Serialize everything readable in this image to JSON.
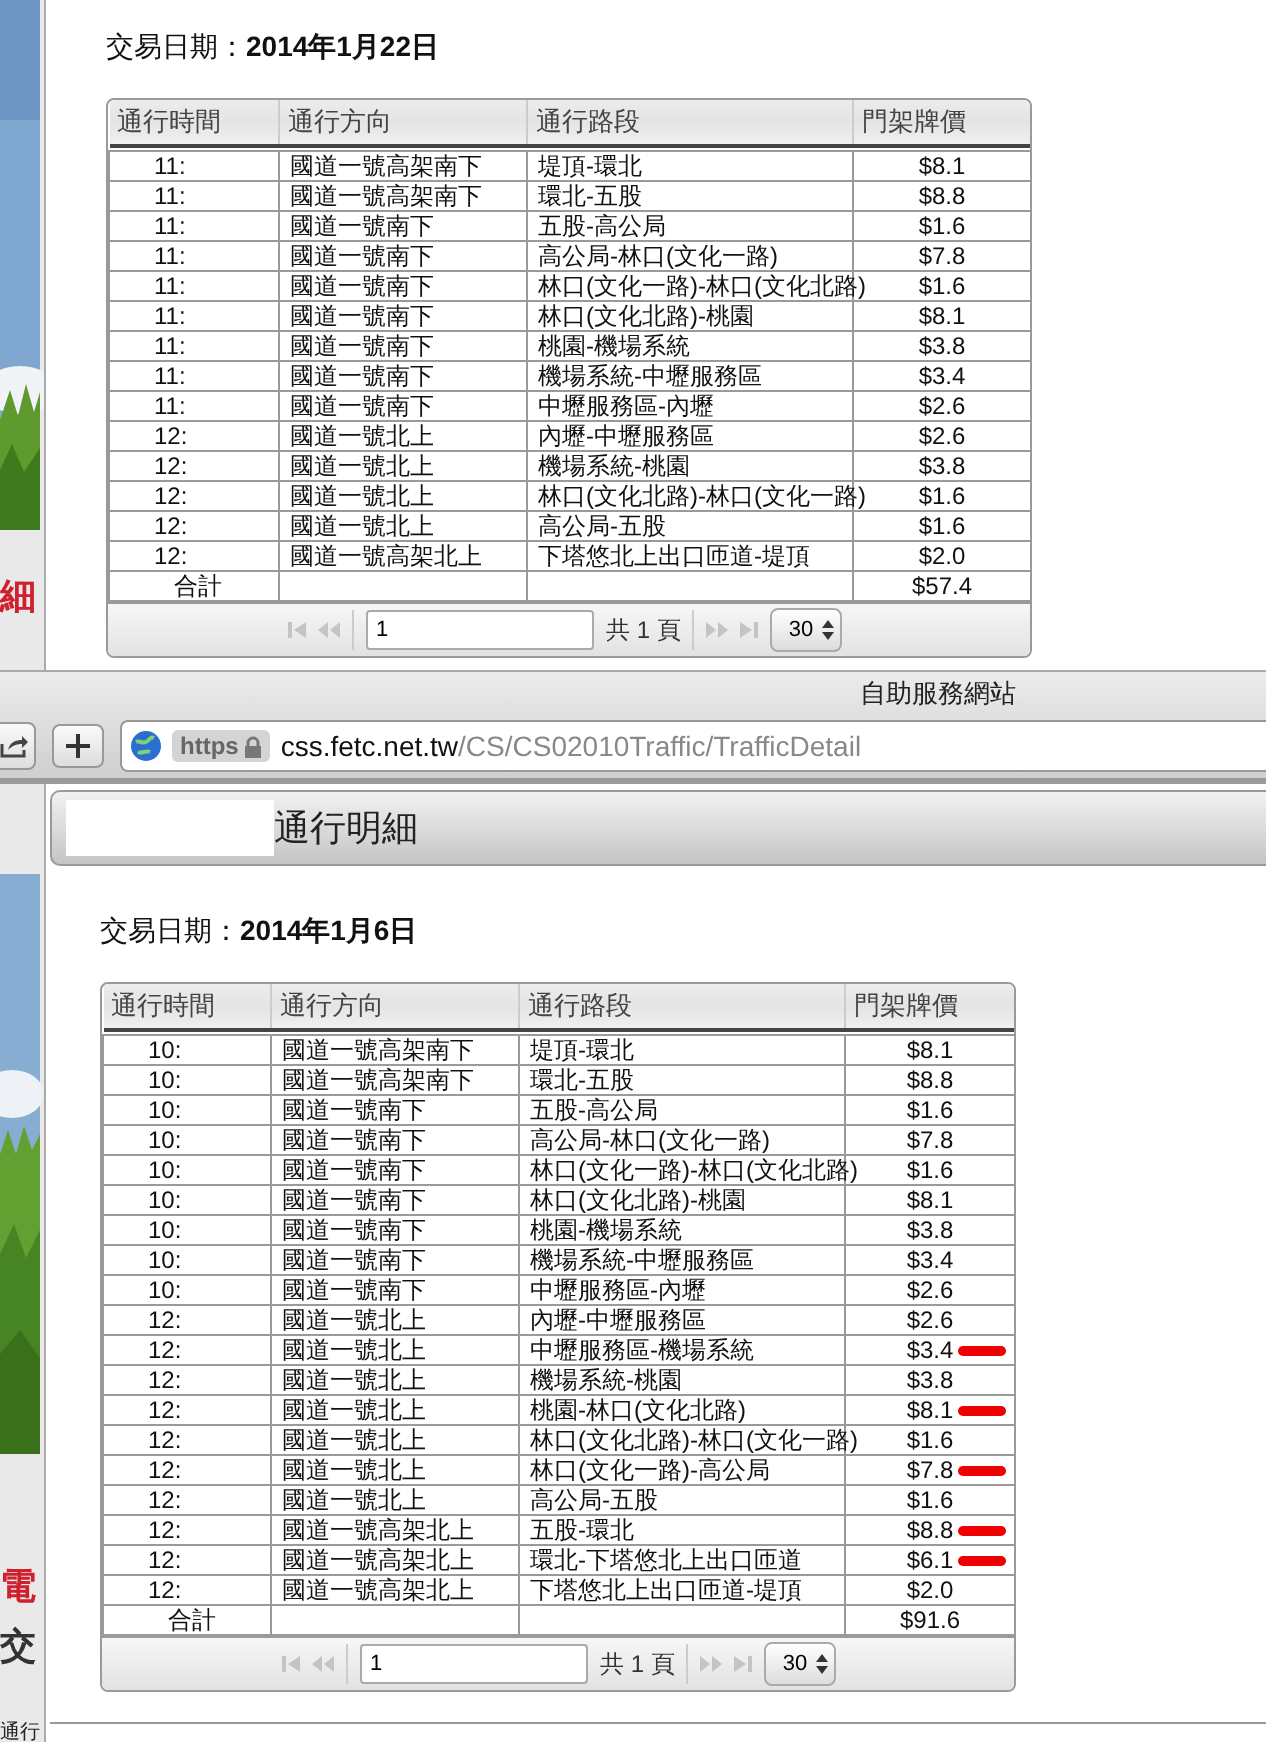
{
  "upper_strip": {
    "texts": [
      {
        "text": "細",
        "color": "#d0202e"
      }
    ]
  },
  "upper_page": {
    "date": "交易日期：**2014年1月22日**",
    "table": {
      "columns": [
        "通行時間",
        "通行方向",
        "通行路段",
        "門架牌價"
      ],
      "rows": [
        {
          "time": "11:",
          "direction": "國道一號高架南下",
          "section": "堤頂-環北",
          "price": "$8.1",
          "marked": false
        },
        {
          "time": "11:",
          "direction": "國道一號高架南下",
          "section": "環北-五股",
          "price": "$8.8",
          "marked": false
        },
        {
          "time": "11:",
          "direction": "國道一號南下",
          "section": "五股-高公局",
          "price": "$1.6",
          "marked": false
        },
        {
          "time": "11:",
          "direction": "國道一號南下",
          "section": "高公局-林口(文化一路)",
          "price": "$7.8",
          "marked": false
        },
        {
          "time": "11:",
          "direction": "國道一號南下",
          "section": "林口(文化一路)-林口(文化北路)",
          "price": "$1.6",
          "marked": false
        },
        {
          "time": "11:",
          "direction": "國道一號南下",
          "section": "林口(文化北路)-桃園",
          "price": "$8.1",
          "marked": false
        },
        {
          "time": "11:",
          "direction": "國道一號南下",
          "section": "桃園-機場系統",
          "price": "$3.8",
          "marked": false
        },
        {
          "time": "11:",
          "direction": "國道一號南下",
          "section": "機場系統-中壢服務區",
          "price": "$3.4",
          "marked": false
        },
        {
          "time": "11:",
          "direction": "國道一號南下",
          "section": "中壢服務區-內壢",
          "price": "$2.6",
          "marked": false
        },
        {
          "time": "12:",
          "direction": "國道一號北上",
          "section": "內壢-中壢服務區",
          "price": "$2.6",
          "marked": false
        },
        {
          "time": "12:",
          "direction": "國道一號北上",
          "section": "機場系統-桃園",
          "price": "$3.8",
          "marked": false
        },
        {
          "time": "12:",
          "direction": "國道一號北上",
          "section": "林口(文化北路)-林口(文化一路)",
          "price": "$1.6",
          "marked": false
        },
        {
          "time": "12:",
          "direction": "國道一號北上",
          "section": "高公局-五股",
          "price": "$1.6",
          "marked": false
        },
        {
          "time": "12:",
          "direction": "國道一號高架北上",
          "section": "下塔悠北上出口匝道-堤頂",
          "price": "$2.0",
          "marked": false
        }
      ],
      "total": {
        "label": "合計",
        "amount": "$57.4"
      },
      "pager": {
        "page": "1",
        "page_count": "共 1 頁",
        "page_size": "30"
      }
    }
  },
  "browser": {
    "title": "自助服務網站",
    "scheme": "https",
    "url_host": "css.fetc.net.tw",
    "url_path": "/CS/CS02010Traffic/TrafficDetail"
  },
  "lower_strip": {
    "texts": [
      {
        "text": "電",
        "color": "#d0202e"
      },
      {
        "text": "交",
        "color": "#333333"
      },
      {
        "text": "通行",
        "color": "#222222"
      }
    ]
  },
  "lower_page": {
    "header": "通行明細",
    "date": "交易日期：**2014年1月6日**",
    "table": {
      "columns": [
        "通行時間",
        "通行方向",
        "通行路段",
        "門架牌價"
      ],
      "rows": [
        {
          "time": "10:",
          "direction": "國道一號高架南下",
          "section": "堤頂-環北",
          "price": "$8.1",
          "marked": false
        },
        {
          "time": "10:",
          "direction": "國道一號高架南下",
          "section": "環北-五股",
          "price": "$8.8",
          "marked": false
        },
        {
          "time": "10:",
          "direction": "國道一號南下",
          "section": "五股-高公局",
          "price": "$1.6",
          "marked": false
        },
        {
          "time": "10:",
          "direction": "國道一號南下",
          "section": "高公局-林口(文化一路)",
          "price": "$7.8",
          "marked": false
        },
        {
          "time": "10:",
          "direction": "國道一號南下",
          "section": "林口(文化一路)-林口(文化北路)",
          "price": "$1.6",
          "marked": false
        },
        {
          "time": "10:",
          "direction": "國道一號南下",
          "section": "林口(文化北路)-桃園",
          "price": "$8.1",
          "marked": false
        },
        {
          "time": "10:",
          "direction": "國道一號南下",
          "section": "桃園-機場系統",
          "price": "$3.8",
          "marked": false
        },
        {
          "time": "10:",
          "direction": "國道一號南下",
          "section": "機場系統-中壢服務區",
          "price": "$3.4",
          "marked": false
        },
        {
          "time": "10:",
          "direction": "國道一號南下",
          "section": "中壢服務區-內壢",
          "price": "$2.6",
          "marked": false
        },
        {
          "time": "12:",
          "direction": "國道一號北上",
          "section": "內壢-中壢服務區",
          "price": "$2.6",
          "marked": false
        },
        {
          "time": "12:",
          "direction": "國道一號北上",
          "section": "中壢服務區-機場系統",
          "price": "$3.4",
          "marked": true
        },
        {
          "time": "12:",
          "direction": "國道一號北上",
          "section": "機場系統-桃園",
          "price": "$3.8",
          "marked": false
        },
        {
          "time": "12:",
          "direction": "國道一號北上",
          "section": "桃園-林口(文化北路)",
          "price": "$8.1",
          "marked": true
        },
        {
          "time": "12:",
          "direction": "國道一號北上",
          "section": "林口(文化北路)-林口(文化一路)",
          "price": "$1.6",
          "marked": false
        },
        {
          "time": "12:",
          "direction": "國道一號北上",
          "section": "林口(文化一路)-高公局",
          "price": "$7.8",
          "marked": true
        },
        {
          "time": "12:",
          "direction": "國道一號北上",
          "section": "高公局-五股",
          "price": "$1.6",
          "marked": false
        },
        {
          "time": "12:",
          "direction": "國道一號高架北上",
          "section": "五股-環北",
          "price": "$8.8",
          "marked": true
        },
        {
          "time": "12:",
          "direction": "國道一號高架北上",
          "section": "環北-下塔悠北上出口匝道",
          "price": "$6.1",
          "marked": true
        },
        {
          "time": "12:",
          "direction": "國道一號高架北上",
          "section": "下塔悠北上出口匝道-堤頂",
          "price": "$2.0",
          "marked": false
        }
      ],
      "total": {
        "label": "合計",
        "amount": "$91.6"
      },
      "pager": {
        "page": "1",
        "page_count": "共 1 頁",
        "page_size": "30"
      }
    }
  }
}
